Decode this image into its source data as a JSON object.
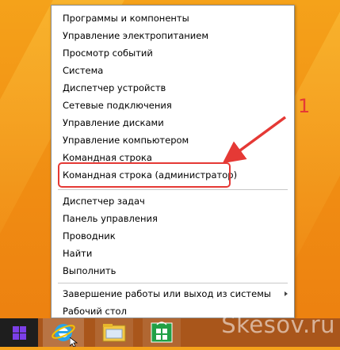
{
  "context_menu": {
    "group1": [
      "Программы и компоненты",
      "Управление электропитанием",
      "Просмотр событий",
      "Система",
      "Диспетчер устройств",
      "Сетевые подключения",
      "Управление дисками",
      "Управление компьютером",
      "Командная строка",
      "Командная строка (администратор)"
    ],
    "group2": [
      "Диспетчер задач",
      "Панель управления",
      "Проводник",
      "Найти",
      "Выполнить"
    ],
    "group3": [
      "Завершение работы или выход из системы",
      "Рабочий стол"
    ]
  },
  "annotation": {
    "number": "1",
    "color": "#e53935"
  },
  "taskbar": {
    "icons": [
      "windows-logo-icon",
      "internet-explorer-icon",
      "file-explorer-icon",
      "windows-store-icon"
    ]
  },
  "watermark": "Skesov.ru"
}
